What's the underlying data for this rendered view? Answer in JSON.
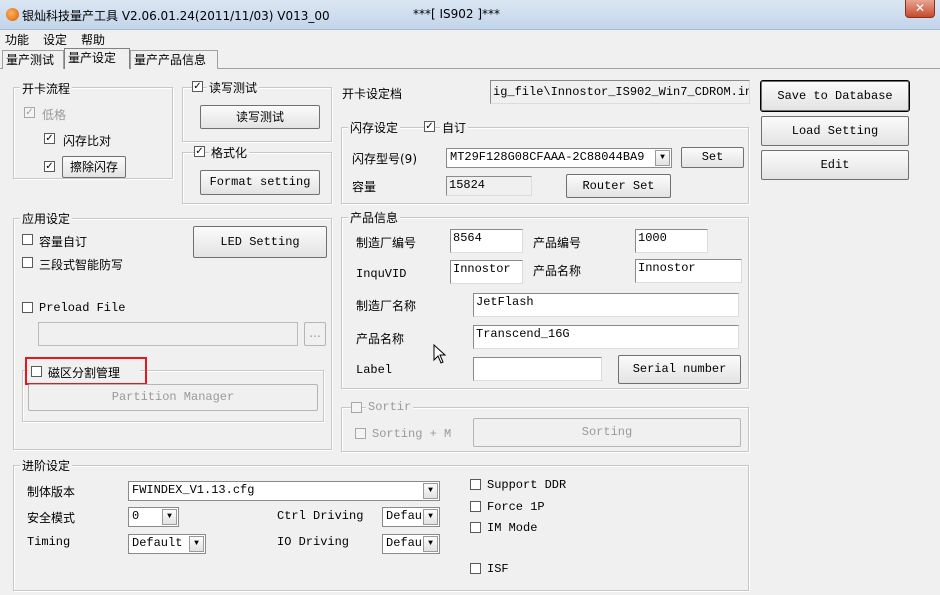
{
  "window": {
    "title": "银灿科技量产工具 V2.06.01.24(2011/11/03)    V013_00",
    "target": "***[ IS902 ]***",
    "close": "✕"
  },
  "menu": [
    "功能",
    "设定",
    "帮助"
  ],
  "tabs": [
    "量产测试",
    "量产设定",
    "量产产品信息"
  ],
  "card_flow": {
    "title": "开卡流程",
    "low_format": "低格",
    "flash_compare": "闪存比对",
    "erase_flash": "擦除闪存"
  },
  "rw_test": {
    "label": "读写测试",
    "button": "读写测试"
  },
  "format": {
    "label": "格式化",
    "button": "Format setting"
  },
  "app_settings": {
    "title": "应用设定",
    "capacity_custom": "容量自订",
    "three_stage": "三段式智能防写",
    "led_button": "LED Setting",
    "preload_file": "Preload File",
    "browse": "...",
    "sector_mgmt": "磁区分割管理",
    "partition_button": "Partition Manager"
  },
  "card_file": {
    "label": "开卡设定档",
    "value": "ig_file\\Innostor_IS902_Win7_CDROM.ini"
  },
  "flash_settings": {
    "title": "闪存设定",
    "auto": "自订",
    "flash_type_label": "闪存型号(9)",
    "flash_type_value": "MT29F128G08CFAAA-2C88044BA9",
    "set_button": "Set",
    "capacity_label": "容量",
    "capacity_value": "15824",
    "router_button": "Router Set"
  },
  "product_info": {
    "title": "产品信息",
    "mfr_id_label": "制造厂编号",
    "mfr_id_value": "8564",
    "product_id_label": "产品编号",
    "product_id_value": "1000",
    "inquvid_label": "InquVID",
    "inquvid_value": "Innostor",
    "product_name_label": "产品名称",
    "product_name_value": "Innostor",
    "mfr_name_label": "制造厂名称",
    "mfr_name_value": "JetFlash",
    "product_name2_label": "产品名称",
    "product_name2_value": "Transcend_16G",
    "label_label": "Label",
    "label_value": "",
    "serial_button": "Serial number"
  },
  "sorting": {
    "title": "Sortir",
    "sorting_m": "Sorting + M",
    "sorting_button": "Sorting"
  },
  "right_buttons": {
    "save": "Save to Database",
    "load": "Load Setting",
    "edit": "Edit"
  },
  "advanced": {
    "title": "进阶设定",
    "firmware_label": "制体版本",
    "firmware_value": "FWINDEX_V1.13.cfg",
    "safe_mode_label": "安全模式",
    "safe_mode_value": "0",
    "ctrl_driving_label": "Ctrl Driving",
    "ctrl_driving_value": "Defau",
    "timing_label": "Timing",
    "timing_value": "Default",
    "io_driving_label": "IO Driving",
    "io_driving_value": "Defau",
    "support_ddr": "Support DDR",
    "force_1p": "Force 1P",
    "im_mode": "IM Mode",
    "isf": "ISF"
  },
  "checkmark": "✓",
  "dropdown_arrow": "▼",
  "colors": {
    "highlight": "#e8171d"
  }
}
